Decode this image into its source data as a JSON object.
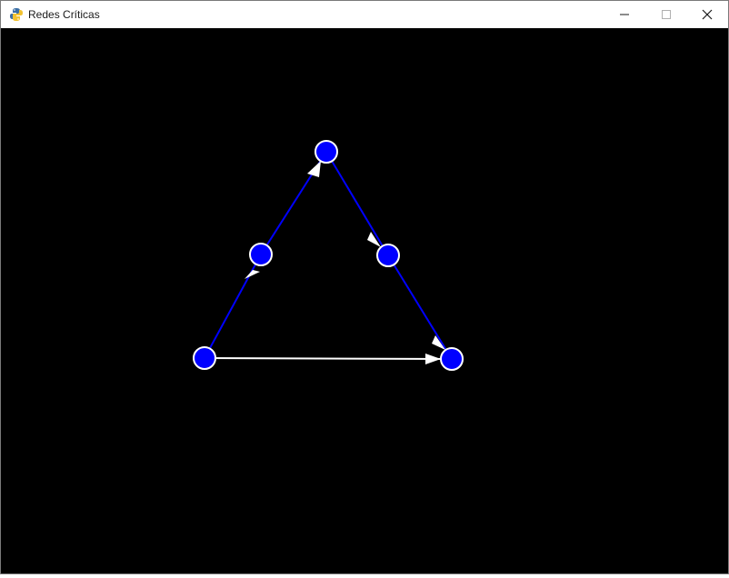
{
  "window": {
    "title": "Redes Críticas",
    "app_icon": "python-snake-icon",
    "controls": [
      "minimize-icon",
      "maximize-icon",
      "close-icon"
    ]
  },
  "colors": {
    "background": "#000000",
    "node_fill": "#0000ff",
    "node_stroke": "#ffffff",
    "active_edge": "#0000ff",
    "inactive_edge": "#ffffff",
    "arrowhead": "#ffffff"
  },
  "graph": {
    "node_count": 5,
    "edges": [
      {
        "from": "bottom-left",
        "to": "left-mid",
        "color": "blue"
      },
      {
        "from": "left-mid",
        "to": "top",
        "color": "blue"
      },
      {
        "from": "top",
        "to": "right-mid",
        "color": "blue"
      },
      {
        "from": "right-mid",
        "to": "bottom-right",
        "color": "blue"
      },
      {
        "from": "bottom-left",
        "to": "bottom-right",
        "color": "white"
      }
    ]
  }
}
